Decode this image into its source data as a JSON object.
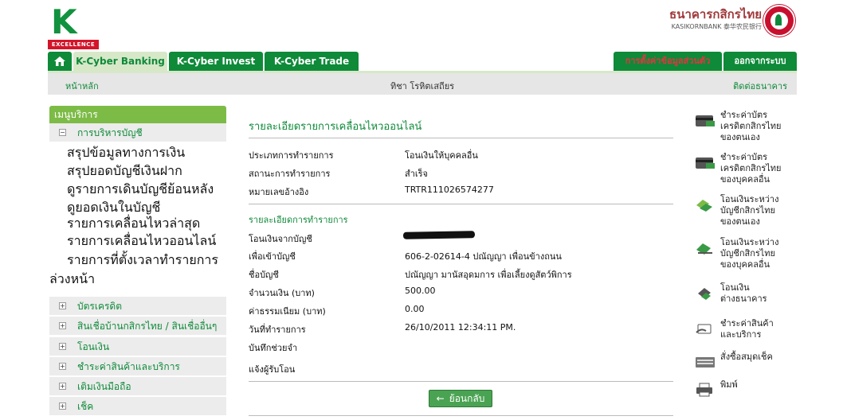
{
  "header": {
    "logo_letter": "K",
    "logo_tag": "EXCELLENCE",
    "bank_name_th": "ธนาคารกสิกรไทย",
    "bank_name_en": "KASIKORNBANK 泰华农民银行"
  },
  "tabs": {
    "banking": "K-Cyber Banking",
    "invest": "K-Cyber Invest",
    "trade": "K-Cyber Trade",
    "settings": "การตั้งค่าข้อมูลส่วนตัว",
    "logout": "ออกจากระบบ"
  },
  "subnav": {
    "home": "หน้าหลัก",
    "user": "ทิชา โรหิตเสถียร",
    "contact": "ติดต่อธนาคาร"
  },
  "sidebar": {
    "title": "เมนูบริการ",
    "open_category": "การบริหารบัญชี",
    "sub_items": [
      "สรุปข้อมูลทางการเงิน",
      "สรุปยอดบัญชีเงินฝาก",
      "ดูรายการเดินบัญชีย้อนหลัง",
      "ดูยอดเงินในบัญชี",
      "รายการเคลื่อนไหวล่าสุด",
      "รายการเคลื่อนไหวออนไลน์",
      "รายการที่ตั้งเวลาทำรายการ",
      "ล่วงหน้า"
    ],
    "categories": [
      "บัตรเครดิต",
      "สินเชื่อบ้านกสิกรไทย / สินเชื่ออื่นๆ",
      "โอนเงิน",
      "ชำระค่าสินค้าและบริการ",
      "เติมเงินมือถือ",
      "เช็ค"
    ]
  },
  "main": {
    "title": "รายละเอียดรายการเคลื่อนไหวออนไลน์",
    "rows": [
      {
        "label": "ประเภทการทำรายการ",
        "value": "โอนเงินให้บุคคลอื่น"
      },
      {
        "label": "สถานะการทำรายการ",
        "value": "สำเร็จ"
      },
      {
        "label": "หมายเลขอ้างอิง",
        "value": "TRTR111026574277"
      }
    ],
    "section_title": "รายละเอียดการทำรายการ",
    "details": [
      {
        "label": "โอนเงินจากบัญชี",
        "value": ""
      },
      {
        "label": "เพื่อเข้าบัญชี",
        "value": "606-2-02614-4 ปณัญญา เพื่อนข้างถนน"
      },
      {
        "label": "ชื่อบัญชี",
        "value": "ปณัญญา มานัสอุดมการ เพื่อเลี้ยงดูสัตว์พิการ"
      },
      {
        "label": "จำนวนเงิน (บาท)",
        "value": "500.00"
      },
      {
        "label": "ค่าธรรมเนียม (บาท)",
        "value": "0.00"
      },
      {
        "label": "วันที่ทำรายการ",
        "value": "26/10/2011 12:34:11 PM."
      },
      {
        "label": "บันทึกช่วยจำ",
        "value": ""
      },
      {
        "label": "แจ้งผู้รับโอน",
        "value": ""
      }
    ],
    "back_label": "ย้อนกลับ"
  },
  "quick_links": [
    {
      "icon": "credit-card-icon",
      "text": "ชำระค่าบัตร\nเครดิตกสิกรไทย\nของตนเอง"
    },
    {
      "icon": "credit-card-icon",
      "text": "ชำระค่าบัตร\nเครดิตกสิกรไทย\nของบุคคลอื่น"
    },
    {
      "icon": "transfer-icon",
      "text": "โอนเงินระหว่าง\nบัญชีกสิกรไทย\nของตนเอง"
    },
    {
      "icon": "transfer-icon",
      "text": "โอนเงินระหว่าง\nบัญชีกสิกรไทย\nของบุคคลอื่น"
    },
    {
      "icon": "transfer-icon",
      "text": "โอนเงิน\nต่างธนาคาร"
    },
    {
      "icon": "bill-payment-icon",
      "text": "ชำระค่าสินค้า\nและบริการ"
    },
    {
      "icon": "cheque-book-icon",
      "text": "สั่งซื้อสมุดเช็ค"
    },
    {
      "icon": "print-icon",
      "text": "พิมพ์"
    }
  ],
  "colors": {
    "brand_green": "#0e8a39",
    "light_green": "#7dbb47",
    "alert_red": "#e5333f",
    "bank_red": "#a0393b"
  }
}
